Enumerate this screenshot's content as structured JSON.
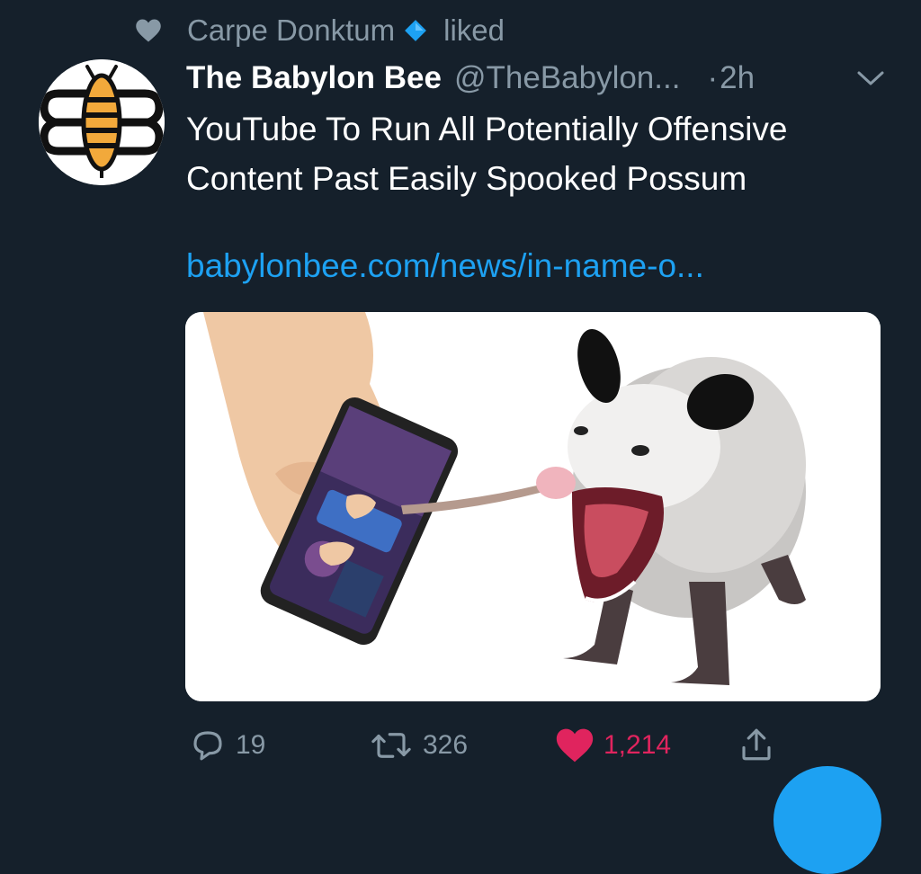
{
  "social_context": {
    "user": "Carpe Donktum",
    "action": "liked"
  },
  "tweet": {
    "author_name": "The Babylon Bee",
    "author_handle": "@TheBabylon...",
    "dot": "·",
    "time": "2h",
    "text": "YouTube To Run All Potentially Offensive Content Past Easily Spooked Possum",
    "link": "babylonbee.com/news/in-name-o...",
    "media_icon": "hand-phone-possum-photo"
  },
  "actions": {
    "replies": "19",
    "retweets": "326",
    "likes": "1,214"
  },
  "colors": {
    "background": "#15202b",
    "secondary_text": "#8899a6",
    "link": "#1da1f2",
    "like": "#e0245e",
    "verified": "#1da1f2"
  }
}
